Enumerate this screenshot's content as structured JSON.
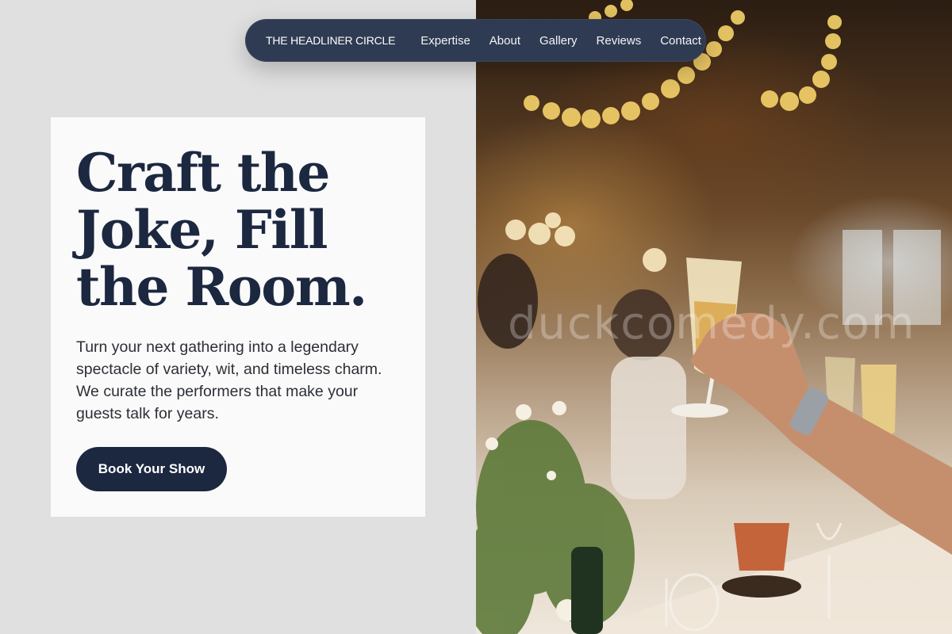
{
  "nav": {
    "brand": "THE HEADLINER CIRCLE",
    "links": [
      "Expertise",
      "About",
      "Gallery",
      "Reviews",
      "Contact"
    ]
  },
  "hero": {
    "headline": "Craft the Joke, Fill the Room.",
    "subtext": "Turn your next gathering into a legendary spectacle of variety, wit, and timeless charm. We curate the performers that make your guests talk for years.",
    "cta_label": "Book Your Show"
  },
  "photo": {
    "watermark": "duckcomedy.com"
  },
  "colors": {
    "page_background": "#e0e0e0",
    "nav_background": "#2f3b52",
    "navy_accent": "#1c2840",
    "card_background": "#fafafa"
  }
}
